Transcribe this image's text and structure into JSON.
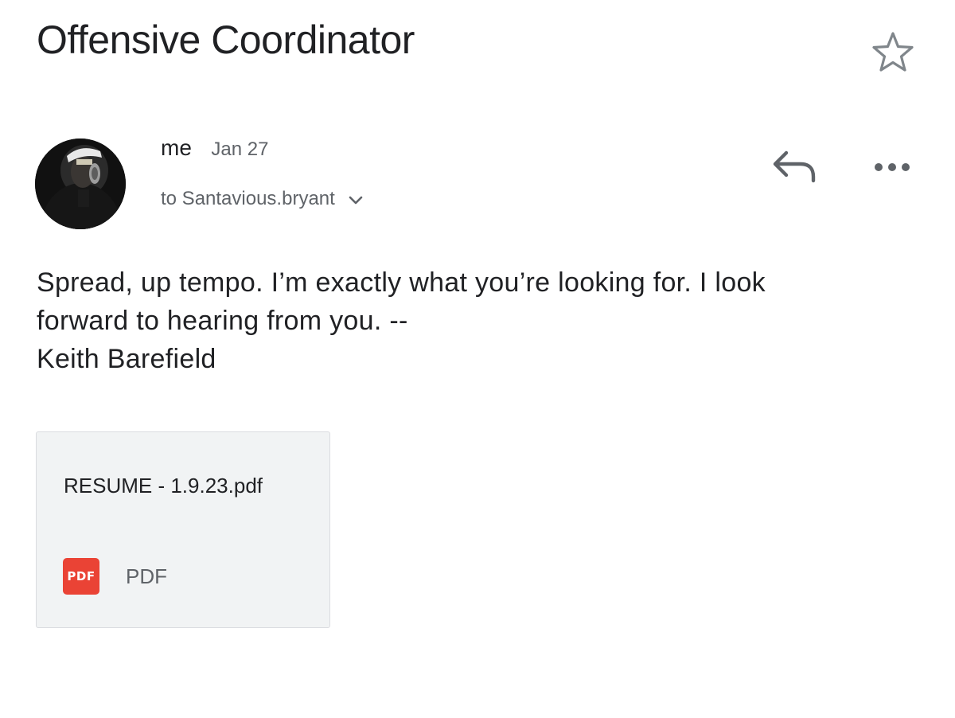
{
  "subject": "Offensive Coordinator",
  "message": {
    "sender": "me",
    "date": "Jan 27",
    "recipient": "to Santavious.bryant",
    "body_lines": [
      "Spread, up tempo. I’m exactly what you’re looking for. I look",
      "forward to hearing from you. --",
      "Keith Barefield"
    ]
  },
  "actions": {
    "star_icon": "star-outline-icon",
    "reply_icon": "reply-arrow-icon",
    "more_icon": "more-horizontal-icon",
    "expand_icon": "chevron-down-icon"
  },
  "attachment": {
    "filename": "RESUME - 1.9.23.pdf",
    "badge": "PDF",
    "type_label": "PDF",
    "badge_color": "#ea4335"
  }
}
